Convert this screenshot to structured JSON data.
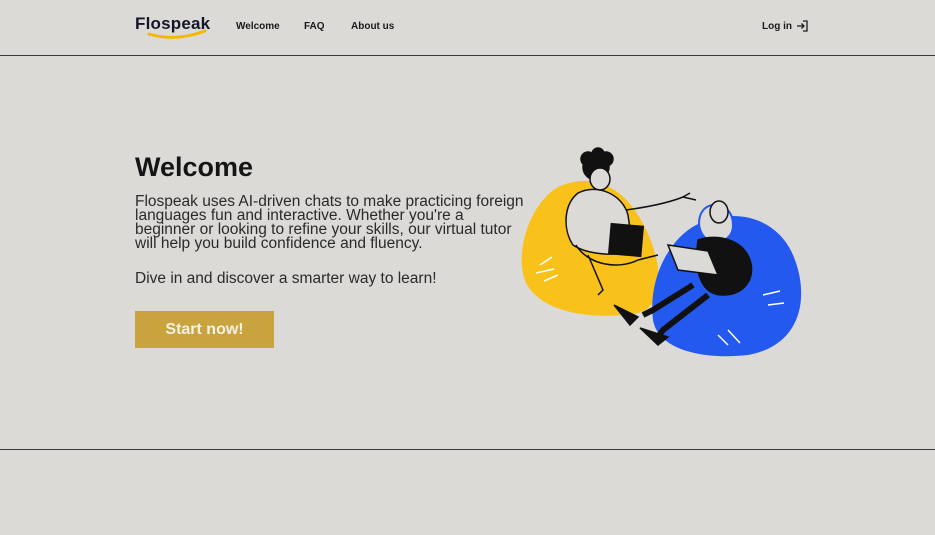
{
  "brand": {
    "name": "Flospeak",
    "accent": "#f5b800",
    "dark": "#15152a"
  },
  "nav": {
    "items": [
      {
        "label": "Welcome"
      },
      {
        "label": "FAQ"
      },
      {
        "label": "About us"
      }
    ],
    "login_label": "Log in",
    "login_icon": "login-arrow-icon"
  },
  "hero": {
    "title": "Welcome",
    "description": "Flospeak uses AI-driven chats to make practicing foreign languages fun and interactive. Whether you're a beginner or looking to refine your skills, our virtual tutor will help you build confidence and fluency.",
    "cta_text": "Dive in and discover a smarter way to learn!",
    "button_label": "Start now!",
    "button_color": "#c9a43e"
  },
  "illustration": {
    "yellow": "#f9c21a",
    "blue": "#2459f0"
  }
}
